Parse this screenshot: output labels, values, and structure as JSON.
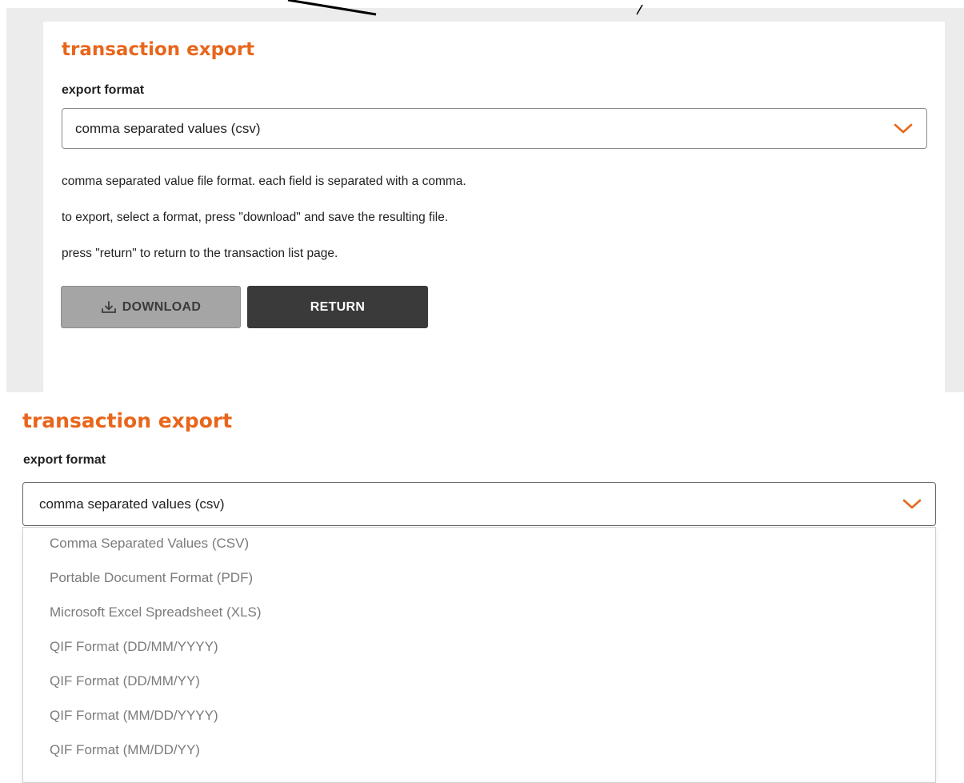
{
  "top_panel": {
    "title": "transaction export",
    "format_label": "export format",
    "selected_format": "comma separated values (csv)",
    "description_lines": [
      "comma separated value file format. each field is separated with a comma.",
      "to export, select a format, press \"download\" and save the resulting file.",
      "press \"return\" to return to the transaction list page."
    ],
    "download_label": "DOWNLOAD",
    "return_label": "RETURN"
  },
  "bottom_panel": {
    "title": "transaction export",
    "format_label": "export format",
    "selected_format": "comma separated values (csv)",
    "options": [
      "Comma Separated Values (CSV)",
      "Portable Document Format (PDF)",
      "Microsoft Excel Spreadsheet (XLS)",
      "QIF Format (DD/MM/YYYY)",
      "QIF Format (DD/MM/YY)",
      "QIF Format (MM/DD/YYYY)",
      "QIF Format (MM/DD/YY)"
    ]
  },
  "icons": {
    "select_chevron": "chevron-down-icon",
    "download": "download-icon"
  },
  "colors": {
    "accent": "#e8661c",
    "download_button_bg": "#a5a5a6",
    "return_button_bg": "#3a3a3a",
    "option_text": "#7b7b7b"
  }
}
